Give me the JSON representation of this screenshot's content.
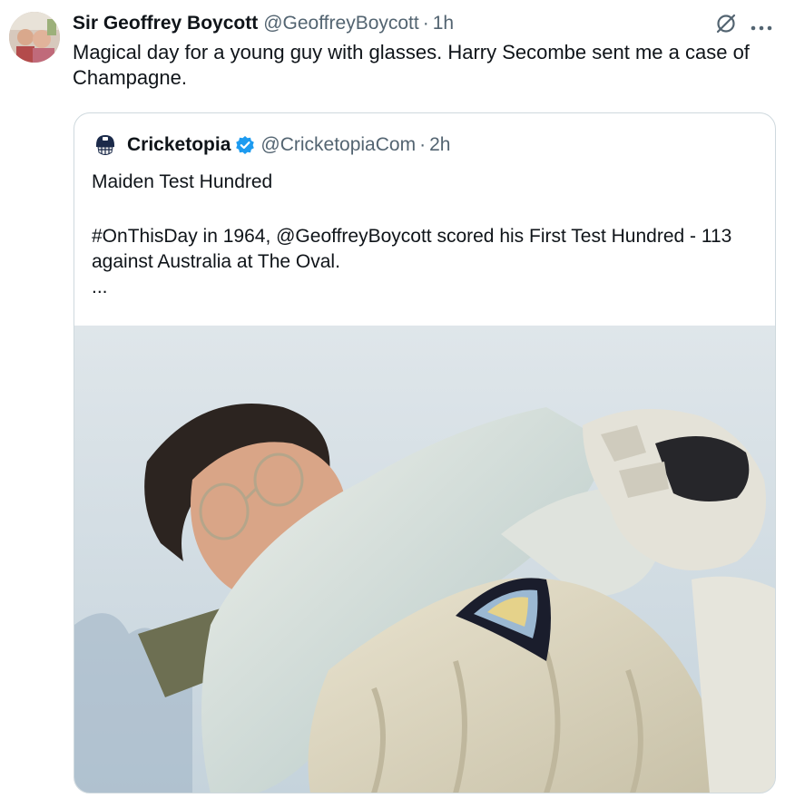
{
  "tweet": {
    "author_name": "Sir Geoffrey Boycott",
    "author_handle": "@GeoffreyBoycott",
    "separator": "·",
    "time": "1h",
    "text": "Magical day for a young guy with glasses. Harry Secombe sent me a case of Champagne.",
    "icons": [
      "grok-icon",
      "more-options-icon"
    ]
  },
  "quoted": {
    "author_name": "Cricketopia",
    "verified": true,
    "author_handle": "@CricketopiaCom",
    "separator": "·",
    "time": "2h",
    "line1": "Maiden Test Hundred",
    "line2": "#OnThisDay in 1964, @GeoffreyBoycott scored his First Test Hundred - 113 against Australia at The Oval.",
    "ellipsis": "...",
    "icons": [
      "helmet-logo-icon",
      "verified-badge-icon"
    ]
  },
  "colors": {
    "text_primary": "#0f1419",
    "text_secondary": "#536471",
    "verified_blue": "#1d9bf0",
    "border": "#cfd9de"
  }
}
